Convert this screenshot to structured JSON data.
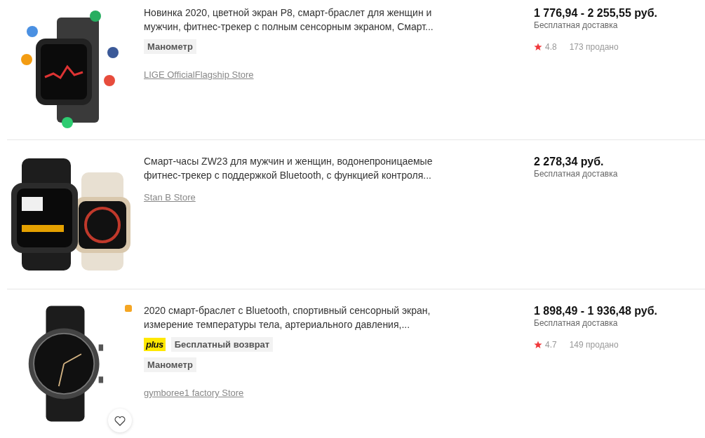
{
  "products": [
    {
      "kind": "square",
      "corner_badge": false,
      "favorite_button": false,
      "title": "Новинка 2020, цветной экран P8, смарт-браслет для женщин и мужчин, фитнес-трекер с полным сенсорным экраном, Смарт...",
      "tag_lines": [
        [
          {
            "kind": "label",
            "text": "Манометр"
          }
        ]
      ],
      "store": "LIGE OfficialFlagship Store",
      "price": "1 776,94 - 2 255,55 руб.",
      "delivery": "Бесплатная доставка",
      "rating": "4.8",
      "sold": "173 продано"
    },
    {
      "kind": "pair",
      "corner_badge": false,
      "favorite_button": false,
      "title": "Смарт-часы ZW23 для мужчин и женщин, водонепроницаемые фитнес-трекер с поддержкой Bluetooth, с функцией контроля...",
      "store": "Stan B Store",
      "price": "2 278,34 руб.",
      "delivery": "Бесплатная доставка"
    },
    {
      "kind": "round",
      "corner_badge": true,
      "favorite_button": true,
      "title": "2020 смарт-браслет с Bluetooth, спортивный сенсорный экран, измерение температуры тела, артериального давления,...",
      "tag_lines": [
        [
          {
            "kind": "plus",
            "text": "plus"
          },
          {
            "kind": "return",
            "text": "Бесплатный возврат"
          }
        ],
        [
          {
            "kind": "label",
            "text": "Манометр"
          }
        ]
      ],
      "store": "gymboree1 factory Store",
      "price": "1 898,49 - 1 936,48 руб.",
      "delivery": "Бесплатная доставка",
      "rating": "4.7",
      "sold": "149 продано"
    }
  ]
}
